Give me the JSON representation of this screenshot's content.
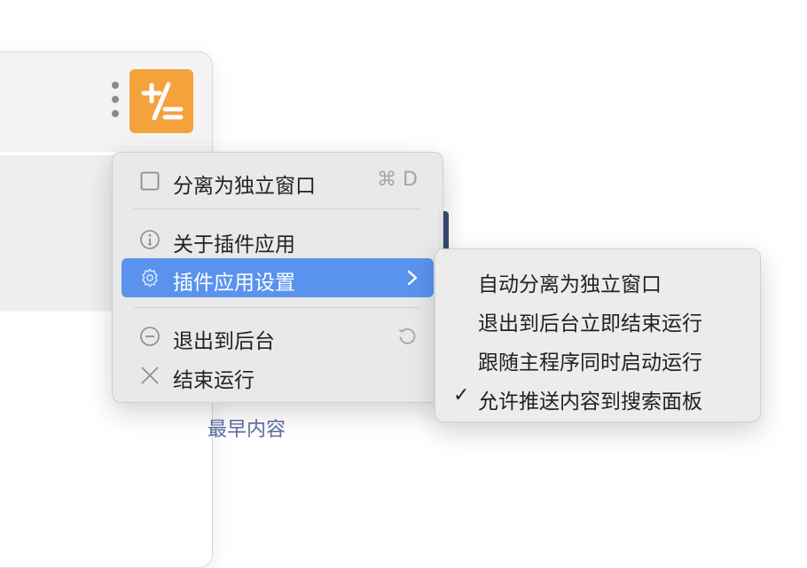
{
  "background": {
    "earliest_link": "最早内容",
    "app_icon_name": "calculator-plusminus-icon",
    "accent": "#f3a23c"
  },
  "menu": {
    "items": [
      {
        "label": "分离为独立窗口",
        "icon": "checkbox-icon",
        "shortcut": "⌘ D"
      },
      {
        "label": "关于插件应用",
        "icon": "info-icon"
      },
      {
        "label": "插件应用设置",
        "icon": "gear-icon",
        "highlighted": true
      },
      {
        "label": "退出到后台",
        "icon": "minus-circle-icon",
        "trailing_icon": "reload-icon"
      },
      {
        "label": "结束运行",
        "icon": "close-icon"
      }
    ],
    "highlight_color": "#5a93ee"
  },
  "submenu": {
    "items": [
      {
        "label": "自动分离为独立窗口",
        "checked": false
      },
      {
        "label": "退出到后台立即结束运行",
        "checked": false
      },
      {
        "label": "跟随主程序同时启动运行",
        "checked": false
      },
      {
        "label": "允许推送内容到搜索面板",
        "checked": true,
        "check_mark": "✓"
      }
    ]
  }
}
